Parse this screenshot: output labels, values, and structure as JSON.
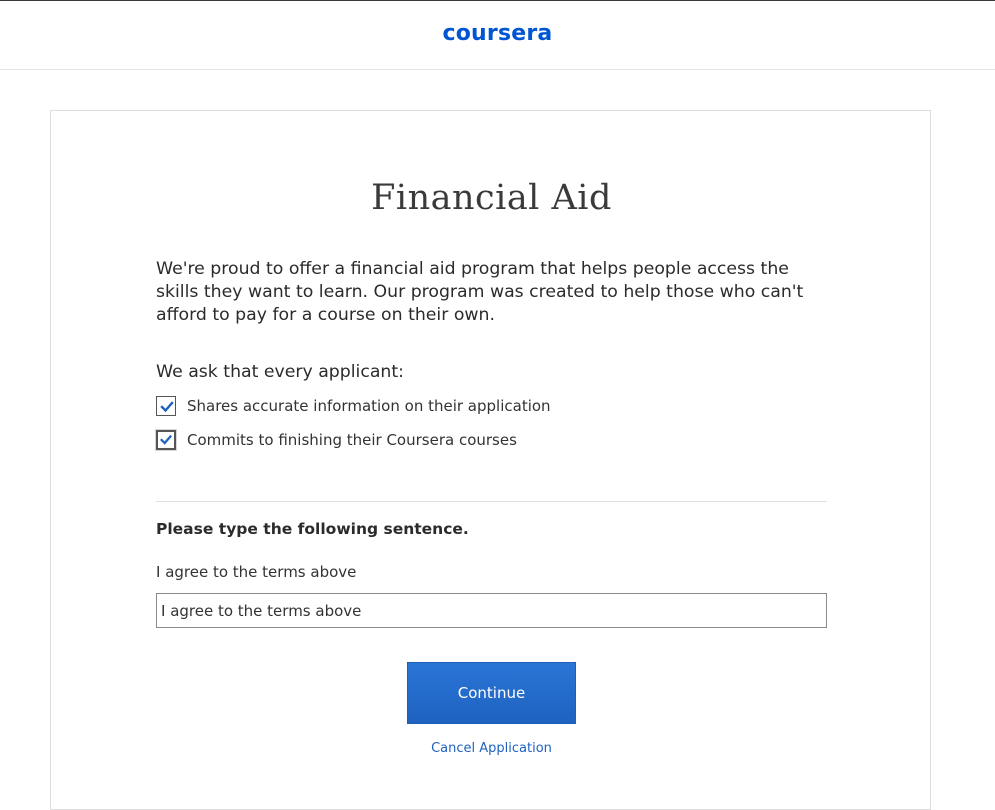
{
  "header": {
    "logo_text": "coursera",
    "brand_color": "#0056d2"
  },
  "main": {
    "title": "Financial Aid",
    "intro": "We're proud to offer a financial aid program that helps people access the skills they want to learn. Our program was created to help those who can't afford to pay for a course on their own.",
    "ask_label": "We ask that every applicant:",
    "checklist": [
      {
        "label": "Shares accurate information on their application",
        "checked": true
      },
      {
        "label": "Commits to finishing their Coursera courses",
        "checked": true
      }
    ],
    "type_heading": "Please type the following sentence.",
    "sentence": "I agree to the terms above",
    "input_value": "I agree to the terms above",
    "continue_label": "Continue",
    "cancel_label": "Cancel Application"
  },
  "colors": {
    "accent": "#1f62c0",
    "checkmark": "#1f62c0"
  }
}
